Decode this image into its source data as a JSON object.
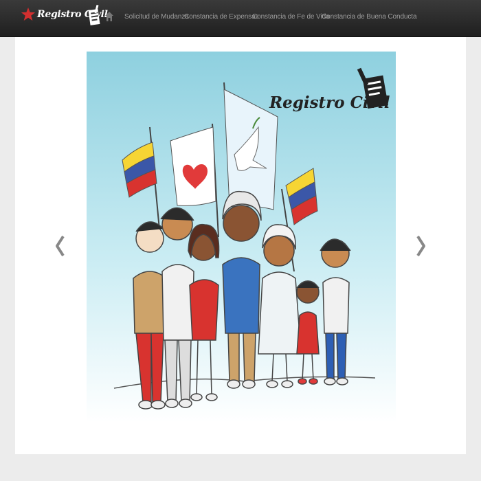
{
  "navbar": {
    "brand_text": "Registro Civil",
    "links": [
      {
        "label": "Solicitud de Mudanza"
      },
      {
        "label": "Constancia de Expensas"
      },
      {
        "label": "Constancia de Fe de Vida"
      },
      {
        "label": "Constancia de Buena Conducta"
      }
    ],
    "icons": {
      "brand": "star-icon",
      "home": "home-icon"
    }
  },
  "carousel": {
    "slide_title": "Registro Civil",
    "prev_icon": "chevron-left-icon",
    "next_icon": "chevron-right-icon"
  },
  "colors": {
    "navbar_bg": "#222222",
    "nav_link": "#9d9d9d",
    "brand_star": "#d32f2f",
    "slide_sky": "#8fd0e0"
  }
}
